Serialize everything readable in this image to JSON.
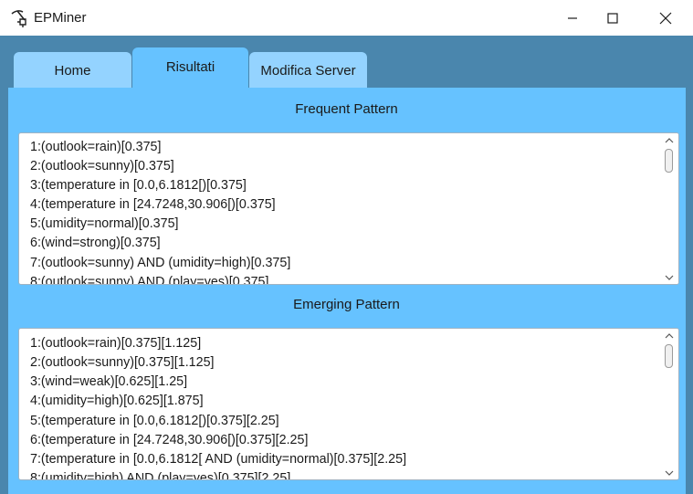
{
  "window": {
    "title": "EPMiner",
    "icon": "pickaxe-icon"
  },
  "tabs": [
    {
      "label": "Home"
    },
    {
      "label": "Risultati"
    },
    {
      "label": "Modifica Server"
    }
  ],
  "frequent": {
    "title": "Frequent Pattern",
    "lines": [
      "1:(outlook=rain)[0.375]",
      "2:(outlook=sunny)[0.375]",
      "3:(temperature in [0.0,6.1812[)[0.375]",
      "4:(temperature in [24.7248,30.906[)[0.375]",
      "5:(umidity=normal)[0.375]",
      "6:(wind=strong)[0.375]",
      "7:(outlook=sunny) AND (umidity=high)[0.375]",
      "8:(outlook=sunny) AND (play=yes)[0.375]"
    ]
  },
  "emerging": {
    "title": "Emerging Pattern",
    "lines": [
      "1:(outlook=rain)[0.375][1.125]",
      "2:(outlook=sunny)[0.375][1.125]",
      "3:(wind=weak)[0.625][1.25]",
      "4:(umidity=high)[0.625][1.875]",
      "5:(temperature in [0.0,6.1812[)[0.375][2.25]",
      "6:(temperature in [24.7248,30.906[)[0.375][2.25]",
      "7:(temperature in [0.0,6.1812[ AND (umidity=normal)[0.375][2.25]",
      "8:(umidity=high) AND (play=yes)[0.375][2.25]"
    ]
  }
}
